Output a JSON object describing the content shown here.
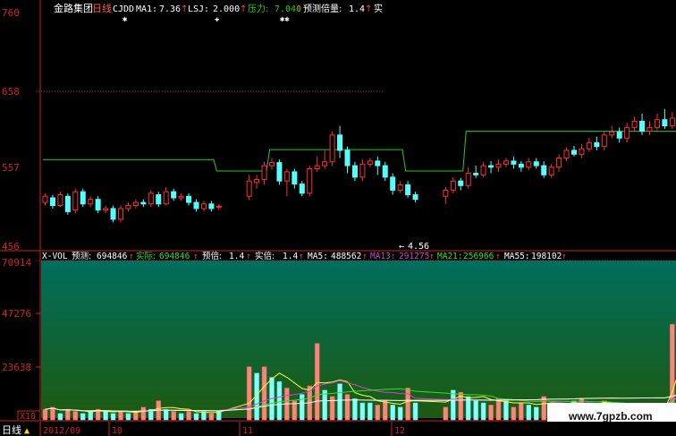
{
  "header": {
    "stock_name": "金路集团",
    "period": "日线",
    "items": [
      {
        "label": "CJDD",
        "color": "#ffffff"
      },
      {
        "label": "MA1:",
        "value": "7.36",
        "color": "#ffffff"
      },
      {
        "label": "LSJ:",
        "value": "2.000",
        "color": "#ffffff"
      },
      {
        "label": "压力:",
        "value": "7.040",
        "color": "#22cc22"
      },
      {
        "label": "预测倍量:",
        "value": "1.4",
        "color": "#ffffff"
      },
      {
        "label": "实",
        "value": "",
        "color": "#ffffff"
      }
    ]
  },
  "price_axis": {
    "ticks": [
      "760",
      "658",
      "557",
      "456"
    ],
    "low_marker": "4.56",
    "low_arrow": "←"
  },
  "volume_header": {
    "items": [
      {
        "label": "X-VOL",
        "value": "",
        "color": "#ffffff"
      },
      {
        "label": "预测:",
        "value": "694846",
        "color": "#ffffff"
      },
      {
        "label": "实际:",
        "value": "694846",
        "color": "#33dd33"
      },
      {
        "label": "预倍:",
        "value": "1.4",
        "color": "#ffffff"
      },
      {
        "label": "实倍:",
        "value": "1.4",
        "color": "#ffffff"
      },
      {
        "label": "MA5:",
        "value": "488562",
        "color": "#ffffff"
      },
      {
        "label": "MA13:",
        "value": "291275",
        "color": "#cc44cc"
      },
      {
        "label": "MA21:",
        "value": "256966",
        "color": "#33dd33"
      },
      {
        "label": "MA55:",
        "value": "198102",
        "color": "#ffffff"
      }
    ]
  },
  "volume_axis": {
    "ticks": [
      "70914",
      "47276",
      "23638"
    ],
    "multiplier": "X10"
  },
  "footer": {
    "period_label": "日线",
    "dates": [
      "2012/09",
      "10",
      "11",
      "12"
    ]
  },
  "watermark": "www.7gpzb.com",
  "colors": {
    "up_candle": "#ff3030",
    "down_candle": "#55ffff",
    "pressure_line": "#22cc22",
    "axis_red": "#cc2222",
    "vol_bg_top": "#006b5a",
    "vol_bg_bottom": "#1f5a10"
  },
  "chart_data": {
    "type": "candlestick",
    "y_price_ticks": [
      760,
      658,
      557,
      456
    ],
    "ylim_price": [
      456,
      760
    ],
    "candles": [
      [
        512,
        520,
        524,
        508
      ],
      [
        518,
        508,
        522,
        504
      ],
      [
        508,
        522,
        526,
        506
      ],
      [
        520,
        500,
        524,
        496
      ],
      [
        502,
        526,
        530,
        498
      ],
      [
        526,
        510,
        530,
        506
      ],
      [
        510,
        516,
        520,
        506
      ],
      [
        516,
        502,
        520,
        498
      ],
      [
        502,
        504,
        508,
        498
      ],
      [
        504,
        490,
        508,
        486
      ],
      [
        490,
        504,
        508,
        486
      ],
      [
        504,
        508,
        512,
        500
      ],
      [
        508,
        512,
        516,
        504
      ],
      [
        512,
        510,
        516,
        506
      ],
      [
        510,
        524,
        528,
        506
      ],
      [
        522,
        510,
        526,
        506
      ],
      [
        510,
        526,
        532,
        508
      ],
      [
        526,
        518,
        530,
        514
      ],
      [
        518,
        520,
        524,
        514
      ],
      [
        520,
        512,
        524,
        508
      ],
      [
        512,
        504,
        516,
        500
      ],
      [
        504,
        510,
        514,
        500
      ],
      [
        510,
        504,
        514,
        500
      ],
      [
        506,
        507,
        510,
        502
      ],
      [
        520,
        540,
        548,
        515
      ],
      [
        538,
        542,
        548,
        530
      ],
      [
        542,
        560,
        565,
        535
      ],
      [
        560,
        564,
        570,
        555
      ],
      [
        564,
        540,
        568,
        535
      ],
      [
        540,
        552,
        556,
        520
      ],
      [
        552,
        536,
        556,
        530
      ],
      [
        536,
        524,
        540,
        520
      ],
      [
        524,
        556,
        560,
        520
      ],
      [
        556,
        560,
        572,
        552
      ],
      [
        560,
        565,
        580,
        556
      ],
      [
        565,
        600,
        605,
        560
      ],
      [
        600,
        580,
        612,
        570
      ],
      [
        580,
        560,
        585,
        550
      ],
      [
        560,
        545,
        565,
        540
      ],
      [
        545,
        562,
        568,
        540
      ],
      [
        562,
        566,
        570,
        558
      ],
      [
        566,
        560,
        572,
        548
      ],
      [
        560,
        545,
        565,
        540
      ],
      [
        545,
        528,
        550,
        522
      ],
      [
        528,
        535,
        540,
        525
      ],
      [
        535,
        522,
        540,
        518
      ],
      [
        522,
        516,
        526,
        512
      ],
      [
        520,
        528,
        532,
        510
      ],
      [
        528,
        540,
        545,
        524
      ],
      [
        540,
        534,
        544,
        528
      ],
      [
        534,
        550,
        558,
        530
      ],
      [
        550,
        548,
        560,
        544
      ],
      [
        548,
        560,
        565,
        545
      ],
      [
        560,
        558,
        566,
        550
      ],
      [
        558,
        562,
        568,
        552
      ],
      [
        562,
        566,
        570,
        558
      ],
      [
        566,
        562,
        572,
        556
      ],
      [
        562,
        558,
        566,
        552
      ],
      [
        558,
        565,
        570,
        554
      ],
      [
        565,
        560,
        570,
        556
      ],
      [
        560,
        548,
        566,
        544
      ],
      [
        548,
        558,
        562,
        544
      ],
      [
        558,
        570,
        575,
        552
      ],
      [
        570,
        580,
        584,
        566
      ],
      [
        580,
        575,
        586,
        572
      ],
      [
        575,
        582,
        588,
        570
      ],
      [
        582,
        590,
        596,
        578
      ],
      [
        590,
        585,
        598,
        580
      ],
      [
        585,
        600,
        605,
        580
      ],
      [
        600,
        604,
        612,
        596
      ],
      [
        604,
        596,
        610,
        590
      ],
      [
        596,
        610,
        616,
        590
      ],
      [
        610,
        618,
        624,
        604
      ],
      [
        618,
        605,
        628,
        600
      ],
      [
        605,
        610,
        618,
        600
      ],
      [
        610,
        620,
        628,
        606
      ],
      [
        620,
        612,
        634,
        608
      ],
      [
        612,
        622,
        630,
        608
      ],
      [
        622,
        614,
        628,
        610
      ],
      [
        614,
        620,
        624,
        610
      ],
      [
        620,
        612,
        634,
        608
      ],
      [
        612,
        600,
        620,
        595
      ],
      [
        600,
        640,
        650,
        598
      ],
      [
        640,
        600,
        642,
        595
      ],
      [
        600,
        610,
        615,
        596
      ]
    ],
    "pressure_line": [
      {
        "from": 0,
        "to": 22,
        "value": 568
      },
      {
        "from": 23,
        "to": 26,
        "value": 553
      },
      {
        "from": 27,
        "to": 44,
        "value": 581
      },
      {
        "from": 45,
        "to": 49,
        "value": 553
      },
      {
        "from": 50,
        "to": 79,
        "value": 605
      },
      {
        "from": 80,
        "to": 81,
        "value": 635
      }
    ],
    "volume": {
      "ylim": [
        0,
        70914
      ],
      "y_ticks": [
        70914,
        47276,
        23638
      ],
      "bars": [
        [
          5,
          1
        ],
        [
          6,
          1
        ],
        [
          3,
          0
        ],
        [
          5,
          1
        ],
        [
          4,
          1
        ],
        [
          3,
          0
        ],
        [
          4,
          0
        ],
        [
          5,
          1
        ],
        [
          4,
          0
        ],
        [
          3,
          0
        ],
        [
          4,
          1
        ],
        [
          3,
          0
        ],
        [
          4,
          1
        ],
        [
          6,
          1
        ],
        [
          5,
          0
        ],
        [
          9,
          1
        ],
        [
          5,
          0
        ],
        [
          4,
          1
        ],
        [
          3,
          0
        ],
        [
          4,
          1
        ],
        [
          3,
          0
        ],
        [
          4,
          0
        ],
        [
          3,
          1
        ],
        [
          4,
          0
        ],
        [
          25,
          1
        ],
        [
          22,
          0
        ],
        [
          25,
          1
        ],
        [
          20,
          0
        ],
        [
          18,
          0
        ],
        [
          15,
          1
        ],
        [
          9,
          1
        ],
        [
          12,
          0
        ],
        [
          16,
          1
        ],
        [
          36,
          1
        ],
        [
          14,
          0
        ],
        [
          11,
          1
        ],
        [
          17,
          0
        ],
        [
          12,
          1
        ],
        [
          10,
          0
        ],
        [
          8,
          0
        ],
        [
          8,
          0
        ],
        [
          7,
          1
        ],
        [
          9,
          1
        ],
        [
          7,
          0
        ],
        [
          6,
          0
        ],
        [
          15,
          1
        ],
        [
          8,
          0
        ],
        [
          6,
          1
        ],
        [
          14,
          0
        ],
        [
          13,
          1
        ],
        [
          11,
          0
        ],
        [
          9,
          0
        ],
        [
          8,
          0
        ],
        [
          7,
          1
        ],
        [
          10,
          1
        ],
        [
          9,
          0
        ],
        [
          6,
          1
        ],
        [
          8,
          1
        ],
        [
          7,
          0
        ],
        [
          6,
          0
        ],
        [
          11,
          1
        ],
        [
          8,
          1
        ],
        [
          7,
          0
        ],
        [
          6,
          0
        ],
        [
          9,
          0
        ],
        [
          10,
          1
        ],
        [
          8,
          0
        ],
        [
          5,
          0
        ],
        [
          9,
          1
        ],
        [
          8,
          0
        ],
        [
          7,
          1
        ],
        [
          6,
          0
        ],
        [
          5,
          1
        ],
        [
          6,
          0
        ],
        [
          5,
          0
        ],
        [
          6,
          1
        ],
        [
          4,
          0
        ],
        [
          45,
          1
        ],
        [
          60,
          1
        ],
        [
          50,
          1
        ]
      ]
    }
  }
}
